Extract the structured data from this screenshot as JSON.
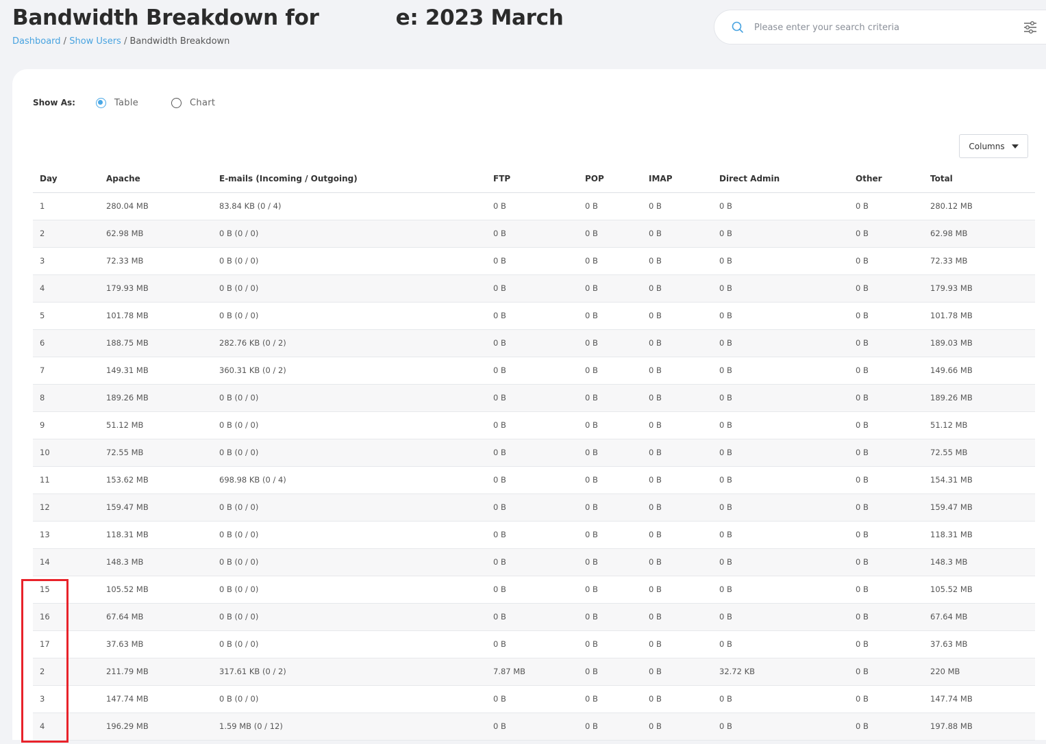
{
  "header": {
    "title_prefix": "Bandwidth Breakdown for",
    "title_suffix": "e: 2023 March"
  },
  "breadcrumb": {
    "items": [
      "Dashboard",
      "Show Users"
    ],
    "current": "Bandwidth Breakdown",
    "separator": "/"
  },
  "search": {
    "placeholder": "Please enter your search criteria",
    "value": ""
  },
  "show_as": {
    "label": "Show As:",
    "options": [
      {
        "label": "Table",
        "checked": true
      },
      {
        "label": "Chart",
        "checked": false
      }
    ]
  },
  "columns_button": {
    "label": "Columns"
  },
  "table": {
    "headers": [
      "Day",
      "Apache",
      "E-mails (Incoming / Outgoing)",
      "FTP",
      "POP",
      "IMAP",
      "Direct Admin",
      "Other",
      "Total"
    ],
    "rows": [
      [
        "1",
        "280.04 MB",
        "83.84 KB (0 / 4)",
        "0 B",
        "0 B",
        "0 B",
        "0 B",
        "0 B",
        "280.12 MB"
      ],
      [
        "2",
        "62.98 MB",
        "0 B (0 / 0)",
        "0 B",
        "0 B",
        "0 B",
        "0 B",
        "0 B",
        "62.98 MB"
      ],
      [
        "3",
        "72.33 MB",
        "0 B (0 / 0)",
        "0 B",
        "0 B",
        "0 B",
        "0 B",
        "0 B",
        "72.33 MB"
      ],
      [
        "4",
        "179.93 MB",
        "0 B (0 / 0)",
        "0 B",
        "0 B",
        "0 B",
        "0 B",
        "0 B",
        "179.93 MB"
      ],
      [
        "5",
        "101.78 MB",
        "0 B (0 / 0)",
        "0 B",
        "0 B",
        "0 B",
        "0 B",
        "0 B",
        "101.78 MB"
      ],
      [
        "6",
        "188.75 MB",
        "282.76 KB (0 / 2)",
        "0 B",
        "0 B",
        "0 B",
        "0 B",
        "0 B",
        "189.03 MB"
      ],
      [
        "7",
        "149.31 MB",
        "360.31 KB (0 / 2)",
        "0 B",
        "0 B",
        "0 B",
        "0 B",
        "0 B",
        "149.66 MB"
      ],
      [
        "8",
        "189.26 MB",
        "0 B (0 / 0)",
        "0 B",
        "0 B",
        "0 B",
        "0 B",
        "0 B",
        "189.26 MB"
      ],
      [
        "9",
        "51.12 MB",
        "0 B (0 / 0)",
        "0 B",
        "0 B",
        "0 B",
        "0 B",
        "0 B",
        "51.12 MB"
      ],
      [
        "10",
        "72.55 MB",
        "0 B (0 / 0)",
        "0 B",
        "0 B",
        "0 B",
        "0 B",
        "0 B",
        "72.55 MB"
      ],
      [
        "11",
        "153.62 MB",
        "698.98 KB (0 / 4)",
        "0 B",
        "0 B",
        "0 B",
        "0 B",
        "0 B",
        "154.31 MB"
      ],
      [
        "12",
        "159.47 MB",
        "0 B (0 / 0)",
        "0 B",
        "0 B",
        "0 B",
        "0 B",
        "0 B",
        "159.47 MB"
      ],
      [
        "13",
        "118.31 MB",
        "0 B (0 / 0)",
        "0 B",
        "0 B",
        "0 B",
        "0 B",
        "0 B",
        "118.31 MB"
      ],
      [
        "14",
        "148.3 MB",
        "0 B (0 / 0)",
        "0 B",
        "0 B",
        "0 B",
        "0 B",
        "0 B",
        "148.3 MB"
      ],
      [
        "15",
        "105.52 MB",
        "0 B (0 / 0)",
        "0 B",
        "0 B",
        "0 B",
        "0 B",
        "0 B",
        "105.52 MB"
      ],
      [
        "16",
        "67.64 MB",
        "0 B (0 / 0)",
        "0 B",
        "0 B",
        "0 B",
        "0 B",
        "0 B",
        "67.64 MB"
      ],
      [
        "17",
        "37.63 MB",
        "0 B (0 / 0)",
        "0 B",
        "0 B",
        "0 B",
        "0 B",
        "0 B",
        "37.63 MB"
      ],
      [
        "2",
        "211.79 MB",
        "317.61 KB (0 / 2)",
        "7.87 MB",
        "0 B",
        "0 B",
        "32.72 KB",
        "0 B",
        "220 MB"
      ],
      [
        "3",
        "147.74 MB",
        "0 B (0 / 0)",
        "0 B",
        "0 B",
        "0 B",
        "0 B",
        "0 B",
        "147.74 MB"
      ],
      [
        "4",
        "196.29 MB",
        "1.59 MB (0 / 12)",
        "0 B",
        "0 B",
        "0 B",
        "0 B",
        "0 B",
        "197.88 MB"
      ]
    ]
  },
  "colors": {
    "accent": "#48a3e0",
    "highlight": "#e8222a",
    "background": "#f2f3f6"
  }
}
